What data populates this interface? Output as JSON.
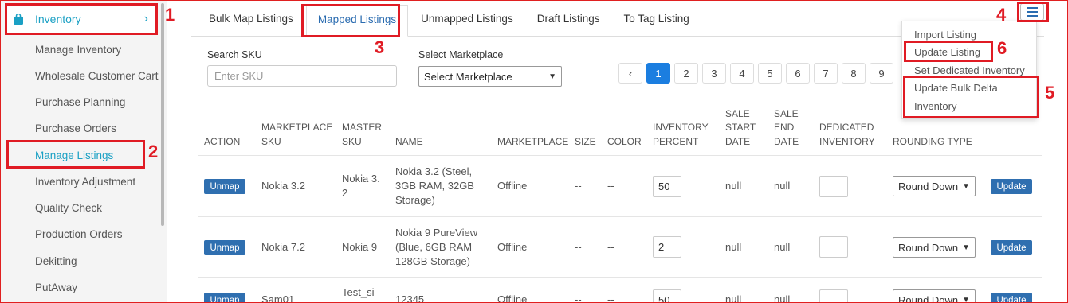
{
  "sidebar": {
    "header": {
      "label": "Inventory",
      "icon": "shopping-bag-icon"
    },
    "items": [
      {
        "label": "Manage Inventory"
      },
      {
        "label": "Wholesale Customer Cart"
      },
      {
        "label": "Purchase Planning"
      },
      {
        "label": "Purchase Orders"
      },
      {
        "label": "Manage Listings"
      },
      {
        "label": "Inventory Adjustment"
      },
      {
        "label": "Quality Check"
      },
      {
        "label": "Production Orders"
      },
      {
        "label": "Dekitting"
      },
      {
        "label": "PutAway"
      }
    ]
  },
  "tabs": [
    {
      "label": "Bulk Map Listings"
    },
    {
      "label": "Mapped Listings"
    },
    {
      "label": "Unmapped Listings"
    },
    {
      "label": "Draft Listings"
    },
    {
      "label": "To Tag Listing"
    }
  ],
  "filters": {
    "sku_label": "Search SKU",
    "sku_placeholder": "Enter SKU",
    "marketplace_label": "Select Marketplace",
    "marketplace_value": "Select Marketplace"
  },
  "pagination": {
    "prev": "‹",
    "pages": [
      "1",
      "2",
      "3",
      "4",
      "5",
      "6",
      "7",
      "8",
      "9"
    ],
    "current": "1"
  },
  "menu": {
    "items": [
      {
        "label": "Import Listing"
      },
      {
        "label": "Update Listing"
      },
      {
        "label": "Set Dedicated Inventory"
      },
      {
        "label": "Update Bulk Delta"
      },
      {
        "label": "Inventory"
      }
    ]
  },
  "annotations": [
    "1",
    "2",
    "3",
    "4",
    "5",
    "6"
  ],
  "table": {
    "headers": {
      "action": "ACTION",
      "mp_sku_1": "MARKETPLACE",
      "mp_sku_2": "SKU",
      "master_sku_1": "MASTER",
      "master_sku_2": "SKU",
      "name": "NAME",
      "marketplace": "MARKETPLACE",
      "size": "SIZE",
      "color": "COLOR",
      "inv_pct_1": "INVENTORY",
      "inv_pct_2": "PERCENT",
      "sale_start_1": "SALE",
      "sale_start_2": "START",
      "sale_start_3": "DATE",
      "sale_end_1": "SALE",
      "sale_end_2": "END",
      "sale_end_3": "DATE",
      "dedicated_1": "DEDICATED",
      "dedicated_2": "INVENTORY",
      "rounding": "ROUNDING TYPE"
    },
    "unmap_label": "Unmap",
    "update_label": "Update",
    "rows": [
      {
        "mp_sku": "Nokia 3.2",
        "master_sku_1": "Nokia 3.",
        "master_sku_2": "2",
        "name_1": "Nokia 3.2 (Steel,",
        "name_2": "3GB RAM, 32GB",
        "name_3": "Storage)",
        "marketplace": "Offline",
        "size": "--",
        "color": "--",
        "inv_pct": "50",
        "sale_start": "null",
        "sale_end": "null",
        "rounding": "Round Down"
      },
      {
        "mp_sku": "Nokia 7.2",
        "master_sku_1": "Nokia 9",
        "master_sku_2": "",
        "name_1": "Nokia 9 PureView",
        "name_2": "(Blue, 6GB RAM",
        "name_3": "128GB Storage)",
        "marketplace": "Offline",
        "size": "--",
        "color": "--",
        "inv_pct": "2",
        "sale_start": "null",
        "sale_end": "null",
        "rounding": "Round Down"
      },
      {
        "mp_sku": "Sam01",
        "master_sku_1": "Test_si",
        "master_sku_2": "",
        "name_1": "12345",
        "name_2": "",
        "name_3": "",
        "marketplace": "Offline",
        "size": "--",
        "color": "--",
        "inv_pct": "50",
        "sale_start": "null",
        "sale_end": "null",
        "rounding": "Round Down"
      }
    ]
  }
}
